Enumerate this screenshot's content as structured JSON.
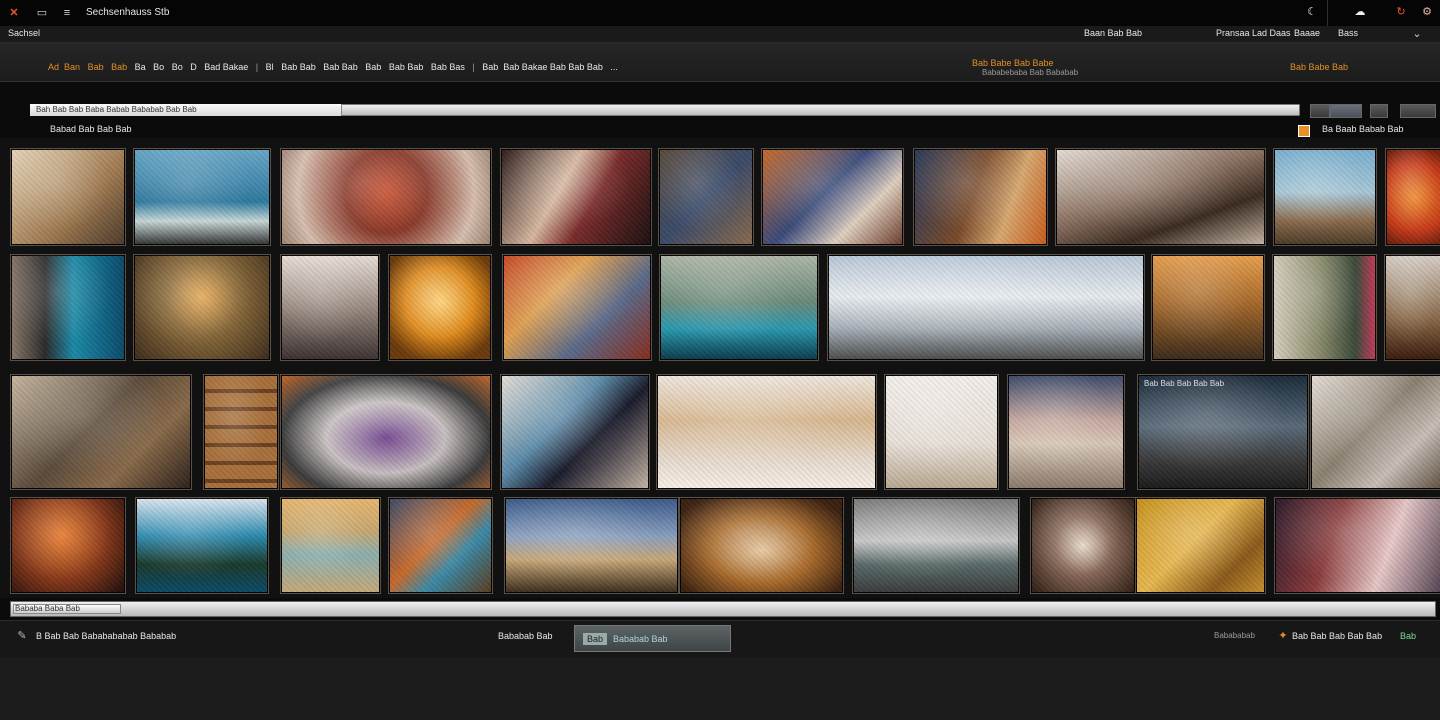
{
  "titlebar": {
    "app_title": "Sechsenhauss  Stb",
    "menu_icon_glyph": "≡",
    "window_icon_glyph": "▭"
  },
  "menubar": {
    "left_label": "Sachsel",
    "right_items": [
      "Baan Bab Bab",
      "Pransaa Lad Daas",
      "Baaae",
      "Bass"
    ],
    "right_icon_glyph": "⌄"
  },
  "toolbar": {
    "items": [
      "Ad",
      "Ban",
      "Bab",
      "Bab",
      "Ba",
      "Bo",
      "Bo",
      "D",
      "Bad Bakae",
      "Bl",
      "Bab Bab",
      "Bab Bab",
      "Bab",
      "Bab Bab",
      "Bab Bas",
      "Bab",
      "Bab Bakae Bab Bab Bab"
    ],
    "ellipsis": "...",
    "center_label": "Bab Babe Bab Babe",
    "center_sublabel": "Bababebaba Bab Bababab",
    "right_label": "Bab Babe Bab"
  },
  "search": {
    "placeholder": "Bah Bab Bab Baba Babab Bababab Bab Bab",
    "filter_label": "Babad Bab Bab  Bab",
    "right_filter_label": "Ba Baab Babab Bab"
  },
  "gallery": {
    "overlay_caption": "Bab Bab Bab Bab Bab"
  },
  "scrollbar": {
    "label": "Bababa Baba Bab"
  },
  "statusbar": {
    "left_text": "B Bab Bab Bababababab Bababab",
    "center_text": "Bababab Bab",
    "center_button_chip": "Bab",
    "center_button_label": "Bababab Bab",
    "right_text_1": "Babababab",
    "right_text_2": "Bab Bab Bab Bab Bab",
    "right_badge": "Bab"
  },
  "colors": {
    "accent": "#e0902a",
    "close": "#e25a2a",
    "status_button_text": "#a9d6e0"
  }
}
